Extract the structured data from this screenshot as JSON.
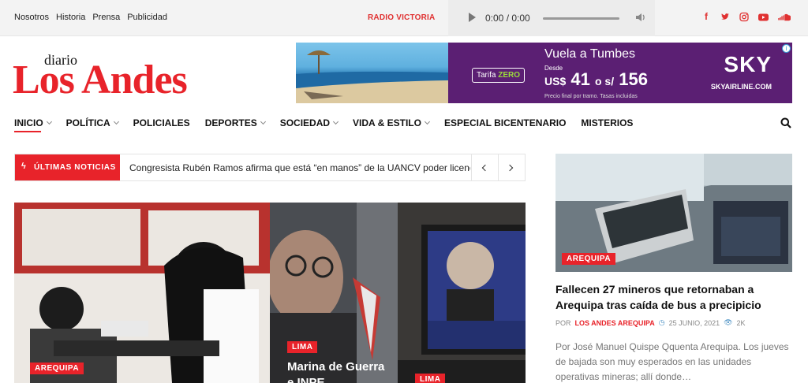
{
  "topbar": {
    "links": [
      "Nosotros",
      "Historia",
      "Prensa",
      "Publicidad"
    ],
    "radio_label": "RADIO VICTORIA",
    "player_time": "0:00 / 0:00",
    "social": [
      "facebook-icon",
      "twitter-icon",
      "instagram-icon",
      "youtube-icon",
      "soundcloud-icon"
    ]
  },
  "logo": {
    "small": "diario",
    "big": "Los Andes"
  },
  "ad": {
    "tarifa": "Tarifa",
    "tarifa_bold": "ZERO",
    "headline": "Vuela a Tumbes",
    "desde": "Desde",
    "price_prefix": "US$",
    "price_usd": "41",
    "price_mid": "o s/",
    "price_sol": "156",
    "fine": "Precio final por tramo. Tasas incluidas",
    "brand": "SKY",
    "url": "SKYAIRLINE.COM"
  },
  "nav": {
    "items": [
      {
        "label": "INICIO",
        "dropdown": true
      },
      {
        "label": "POLÍTICA",
        "dropdown": true
      },
      {
        "label": "POLICIALES",
        "dropdown": false
      },
      {
        "label": "DEPORTES",
        "dropdown": true
      },
      {
        "label": "SOCIEDAD",
        "dropdown": true
      },
      {
        "label": "VIDA & ESTILO",
        "dropdown": true
      },
      {
        "label": "ESPECIAL BICENTENARIO",
        "dropdown": false
      },
      {
        "label": "MISTERIOS",
        "dropdown": false
      }
    ]
  },
  "ticker": {
    "label": "ÚLTIMAS NOTICIAS",
    "text": "Congresista Rubén Ramos afirma que está “en manos” de la UANCV poder licencia…"
  },
  "cards": {
    "first_badge": "AREQUIPA",
    "second_badge": "LIMA",
    "second_title": "Marina de Guerra",
    "second_title2": "e INPE",
    "third_badge": "LIMA"
  },
  "sidebar": {
    "badge": "AREQUIPA",
    "title": "Fallecen 27 mineros que retornaban a Arequipa tras caída de bus a precipicio",
    "by": "POR",
    "author": "LOS ANDES AREQUIPA",
    "date": "25 JUNIO, 2021",
    "views": "2K",
    "excerpt": "Por José Manuel Quispe Qquenta Arequipa. Los jueves de bajada son muy esperados en las unidades operativas mineras; allí donde…"
  },
  "colors": {
    "accent": "#e8232a",
    "ad_purple": "#5b1f73"
  }
}
